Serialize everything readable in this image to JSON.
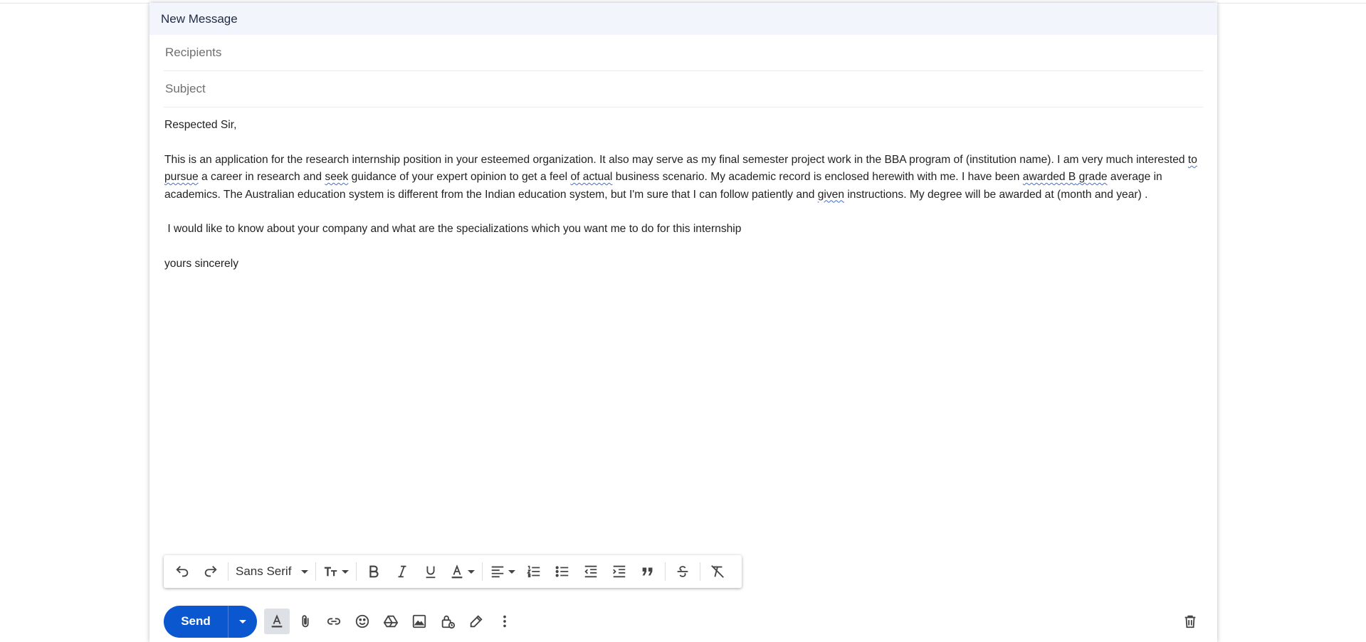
{
  "compose": {
    "title": "New Message",
    "recipients_placeholder": "Recipients",
    "subject_placeholder": "Subject",
    "body": {
      "greeting": "Respected Sir,",
      "p1_a": "This is an application for the research internship position in your esteemed organization. It also may serve as my final semester project work in the BBA program of (institution name). I am very much interested ",
      "p1_b": "to pursue",
      "p1_c": " a career in research and ",
      "p1_d": "seek",
      "p1_e": " guidance of your expert opinion to get a feel ",
      "p1_f": "of actual",
      "p1_g": " business scenario. My academic record is enclosed herewith with me. I have been ",
      "p1_h": "awarded B",
      "p1_h2": " grade",
      "p1_i": " average in academics. The Australian education system is different from the Indian education system, but I'm sure that I can follow patiently and ",
      "p1_j": "given",
      "p1_k": " instructions. My degree will be awarded at (month and year) .",
      "p2": " I would like to know about your company and what are the specializations which you want me to do for this internship",
      "closing": "yours sincerely"
    }
  },
  "format_bar": {
    "font_family": "Sans Serif",
    "icons": [
      "undo-icon",
      "redo-icon",
      "font-size-icon",
      "bold-icon",
      "italic-icon",
      "underline-icon",
      "text-color-icon",
      "align-icon",
      "numbered-list-icon",
      "bulleted-list-icon",
      "indent-less-icon",
      "indent-more-icon",
      "quote-icon",
      "strikethrough-icon",
      "remove-formatting-icon"
    ]
  },
  "bottom_bar": {
    "send_label": "Send",
    "icons": [
      "formatting-options-icon",
      "attach-icon",
      "link-icon",
      "emoji-icon",
      "drive-icon",
      "photo-icon",
      "confidential-mode-icon",
      "signature-icon",
      "more-options-icon",
      "discard-icon"
    ]
  },
  "colors": {
    "send_button": "#0b57d0",
    "header_bg": "#f2f6fc",
    "spellcheck_underline": "#3b6fd8"
  }
}
